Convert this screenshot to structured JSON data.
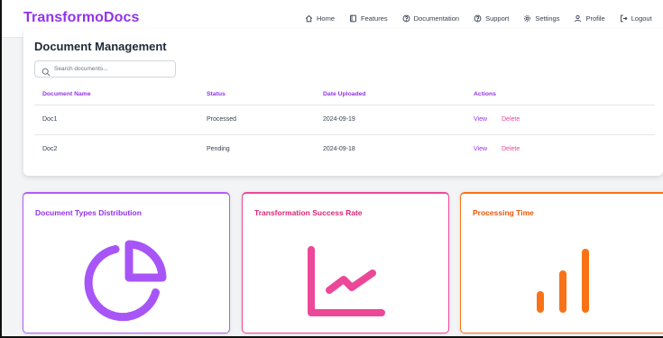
{
  "navbar": {
    "brand": "TransformoDocs",
    "links": [
      {
        "label": "Home",
        "icon": "home-icon"
      },
      {
        "label": "Features",
        "icon": "features-icon"
      },
      {
        "label": "Documentation",
        "icon": "documentation-icon"
      },
      {
        "label": "Support",
        "icon": "support-icon"
      },
      {
        "label": "Settings",
        "icon": "settings-icon"
      },
      {
        "label": "Profile",
        "icon": "profile-icon"
      },
      {
        "label": "Logout",
        "icon": "logout-icon"
      }
    ]
  },
  "documents": {
    "title": "Document Management",
    "search_placeholder": "Search documents...",
    "columns": [
      "Document Name",
      "Status",
      "Date Uploaded",
      "Actions"
    ],
    "rows": [
      {
        "name": "Doc1",
        "status": "Processed",
        "date": "2024-09-19",
        "view": "View",
        "delete": "Delete"
      },
      {
        "name": "Doc2",
        "status": "Pending",
        "date": "2024-09-18",
        "view": "View",
        "delete": "Delete"
      }
    ]
  },
  "cards": [
    {
      "title": "Document Types Distribution",
      "icon": "pie-chart-icon",
      "color": "#a855f7"
    },
    {
      "title": "Transformation Success Rate",
      "icon": "line-chart-icon",
      "color": "#ec4899"
    },
    {
      "title": "Processing Time",
      "icon": "bar-chart-icon",
      "color": "#f97316"
    }
  ]
}
